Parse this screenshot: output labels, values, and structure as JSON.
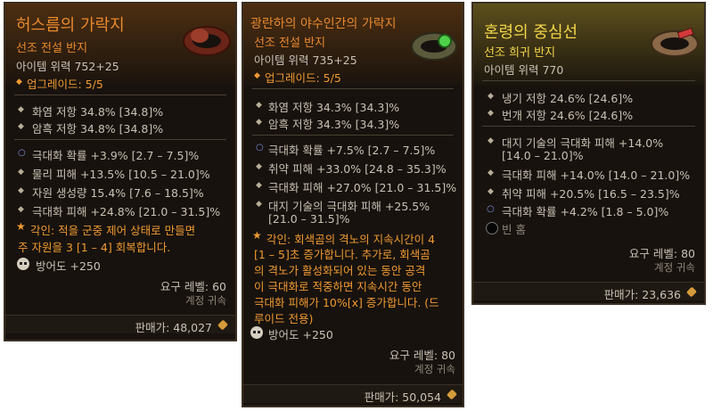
{
  "cards": [
    {
      "title": "허스름의 가락지",
      "subtitle": "선조 전설 반지",
      "power": "아이템 위력 752+25",
      "upgrade": "업그레이드: 5/5",
      "implicits": [
        "화염 저항 34.8% [34.8]%",
        "암흑 저항 34.8% [34.8]%"
      ],
      "affixes": [
        {
          "bullet": "greater",
          "text": "극대화 확률 +3.9% [2.7 – 7.5]%"
        },
        {
          "bullet": "normal",
          "text": "물리 피해 +13.5% [10.5 – 21.0]%"
        },
        {
          "bullet": "normal",
          "text": "자원 생성량 15.4% [7.6 – 18.5]%"
        },
        {
          "bullet": "normal",
          "text": "극대화 피해 +24.8% [21.0 – 31.5]%"
        }
      ],
      "aspect_lines": [
        "각인: 적을 군중 제어 상태로 만들면",
        "주 자원을 3 [1 – 4] 회복합니다."
      ],
      "armor": "방어도 +250",
      "required_level": "요구 레벨: 60",
      "account_bound": "계정 귀속",
      "sell_price": "판매가: 48,027"
    },
    {
      "title": "광란하의 야수인간의 가락지",
      "subtitle": "선조 전설 반지",
      "power": "아이템 위력 735+25",
      "upgrade": "업그레이드: 5/5",
      "implicits": [
        "화염 저항 34.3% [34.3]%",
        "암흑 저항 34.3% [34.3]%"
      ],
      "affixes": [
        {
          "bullet": "greater",
          "text": "극대화 확률 +7.5% [2.7 – 7.5]%"
        },
        {
          "bullet": "normal",
          "text": "취약 피해 +33.0% [24.8 – 35.3]%"
        },
        {
          "bullet": "normal",
          "text": "극대화 피해 +27.0% [21.0 – 31.5]%"
        },
        {
          "bullet": "normal",
          "text": "대지 기술의 극대화 피해 +25.5%"
        },
        {
          "bullet": "none",
          "text": "[21.0 – 31.5]%"
        }
      ],
      "aspect_lines": [
        "각인: 회색곰의 격노의 지속시간이 4",
        "[1 – 5]초 증가합니다. 추가로, 회색곰",
        "의 격노가 활성화되어 있는 동안 공격",
        "이 극대화로 적중하면 지속시간 동안",
        "극대화 피해가 10%[x] 증가합니다. (드",
        "루이드 전용)"
      ],
      "armor": "방어도 +250",
      "required_level": "요구 레벨: 80",
      "account_bound": "계정 귀속",
      "sell_price": "판매가: 50,054"
    },
    {
      "title": "혼령의 중심선",
      "subtitle": "선조 희귀 반지",
      "power": "아이템 위력 770",
      "implicits": [
        "냉기 저항 24.6% [24.6]%",
        "번개 저항 24.6% [24.6]%"
      ],
      "affixes": [
        {
          "bullet": "normal",
          "text": "대지 기술의 극대화 피해 +14.0%"
        },
        {
          "bullet": "none",
          "text": "[14.0 – 21.0]%"
        },
        {
          "bullet": "normal",
          "text": "극대화 피해 +14.0% [14.0 – 21.0]%"
        },
        {
          "bullet": "normal",
          "text": "취약 피해 +20.5% [16.5 – 23.5]%"
        },
        {
          "bullet": "greater",
          "text": "극대화 확률 +4.2% [1.8 – 5.0]%"
        }
      ],
      "socket": "빈 홈",
      "required_level": "요구 레벨: 80",
      "account_bound": "계정 귀속",
      "sell_price": "판매가: 23,636"
    }
  ],
  "colors": {
    "legendary": "#e8892e",
    "rare": "#f2d54a",
    "greater_bullet": "#7f95e6"
  }
}
